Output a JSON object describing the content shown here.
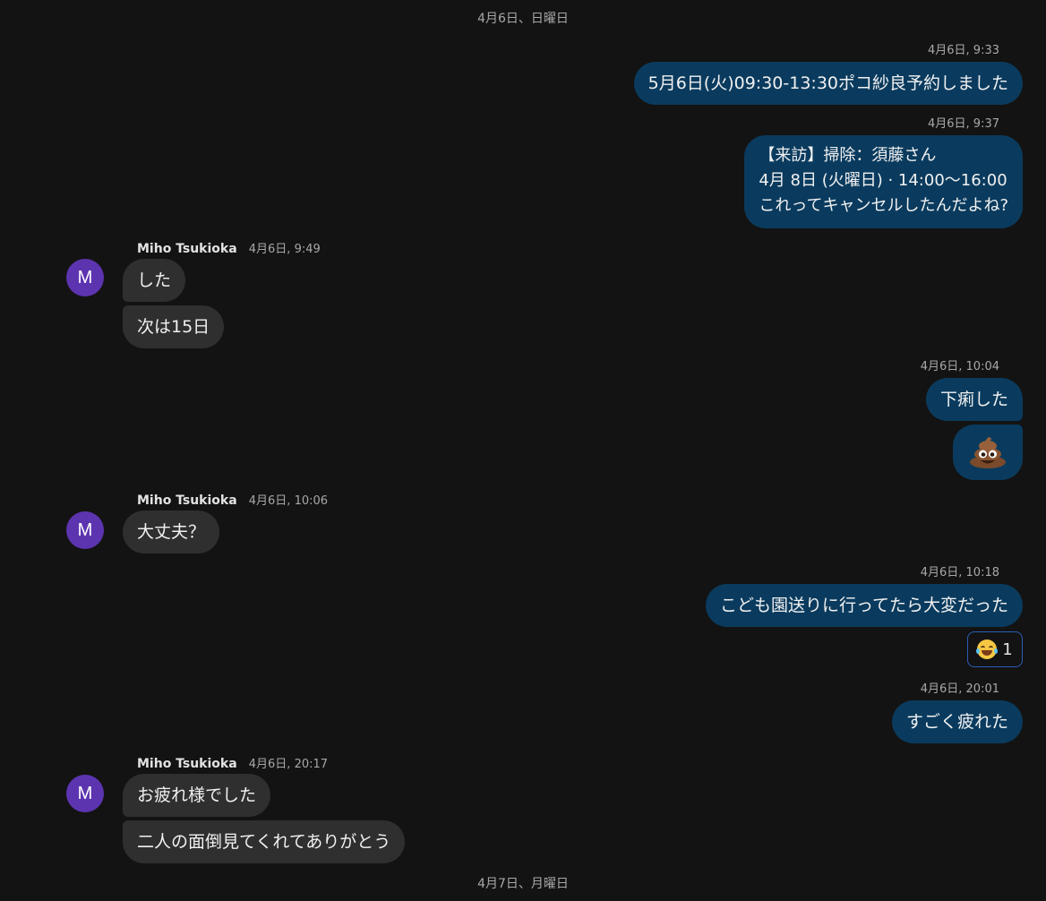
{
  "dividers": {
    "day1": "4月6日、日曜日",
    "day2": "4月7日、月曜日"
  },
  "messages": {
    "m1": {
      "time": "4月6日, 9:33",
      "text": "5月6日(火)09:30-13:30ポコ紗良予約しました"
    },
    "m2": {
      "time": "4月6日, 9:37",
      "line1": "【来訪】掃除：須藤さん",
      "line2": "4月 8日 (火曜日) · 14:00〜16:00",
      "line3": "これってキャンセルしたんだよね?"
    },
    "m3": {
      "sender": "Miho Tsukioka",
      "time": "4月6日, 9:49",
      "text1": "した",
      "text2": "次は15日"
    },
    "m4": {
      "time": "4月6日, 10:04",
      "text": "下痢した",
      "emoji": "pile-of-poo-emoji"
    },
    "m5": {
      "sender": "Miho Tsukioka",
      "time": "4月6日, 10:06",
      "text": "大丈夫？"
    },
    "m6": {
      "time": "4月6日, 10:18",
      "text": "こども園送りに行ってたら大変だった",
      "reaction_icon": "face-with-tears-of-joy-emoji",
      "reaction_count": "1"
    },
    "m7": {
      "time": "4月6日, 20:01",
      "text": "すごく疲れた"
    },
    "m8": {
      "sender": "Miho Tsukioka",
      "time": "4月6日, 20:17",
      "text1": "お疲れ様でした",
      "text2": "二人の面倒見てくれてありがとう"
    }
  },
  "avatar": {
    "initial": "M",
    "color": "#5d34b0"
  },
  "colors": {
    "background": "#131313",
    "outgoing_bubble": "#0a3b5e",
    "incoming_bubble": "#2f2f2f",
    "reaction_border": "#2b5db2"
  }
}
